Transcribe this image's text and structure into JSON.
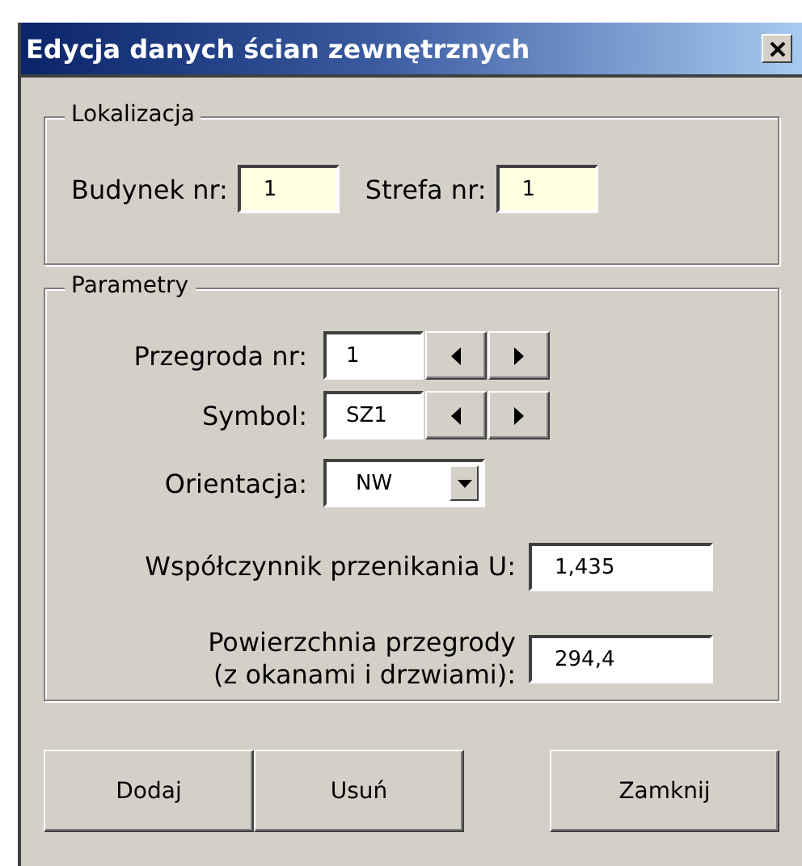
{
  "window": {
    "title": "Edycja danych ścian zewnętrznych"
  },
  "location": {
    "label": "Lokalizacja",
    "fields": [
      {
        "label": "Budynek nr:",
        "value": "1"
      },
      {
        "label": "Strefa nr:",
        "value": "1"
      }
    ]
  },
  "parameters": {
    "label": "Parametry",
    "rows": [
      {
        "kind": "stepper",
        "label": "Przegroda nr:",
        "value": "1"
      },
      {
        "kind": "stepper",
        "label": "Symbol:",
        "value": "SZ1"
      },
      {
        "kind": "select",
        "label": "Orientacja:",
        "value": "NW"
      },
      {
        "kind": "text",
        "label": "Współczynnik przenikania U:",
        "value": "1,435"
      },
      {
        "kind": "text",
        "label": "Powierzchnia przegrody\n(z okanami i drzwiami):",
        "value": "294,4"
      }
    ]
  },
  "button_groups": [
    [
      "Dodaj",
      "Usuń"
    ],
    [
      "Zamknij"
    ]
  ]
}
